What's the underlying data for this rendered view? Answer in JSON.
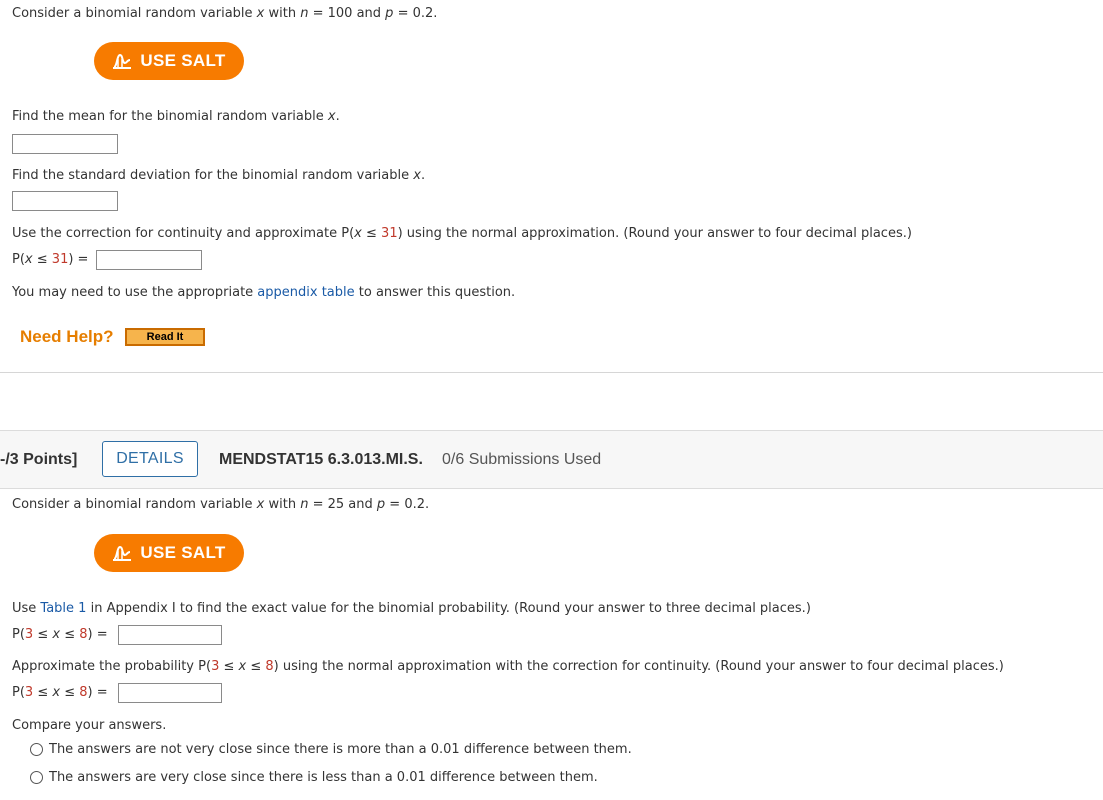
{
  "q1": {
    "intro": {
      "pre": "Consider a binomial random variable ",
      "var": "x",
      "mid1": " with ",
      "n_var": "n",
      "n_val": " = 100 and ",
      "p_var": "p",
      "p_val": " = 0.2."
    },
    "salt_label": "USE SALT",
    "mean_prompt": {
      "pre": "Find the mean for the binomial random variable ",
      "var": "x",
      "post": "."
    },
    "sd_prompt": {
      "pre": "Find the standard deviation for the binomial random variable ",
      "var": "x",
      "post": "."
    },
    "cont_prompt": {
      "pre": "Use the correction for continuity and approximate ",
      "p": "P(",
      "var": "x",
      "le": " ≤ ",
      "num": "31",
      "post": ") using the normal approximation. (Round your answer to four decimal places.)"
    },
    "answer_label": {
      "p": "P(",
      "var": "x",
      "le": " ≤ ",
      "num": "31",
      "close": ") ="
    },
    "appendix_note": {
      "pre": "You may need to use the appropriate ",
      "link": "appendix table",
      "post": " to answer this question."
    },
    "need_help": "Need Help?",
    "read_it": "Read It"
  },
  "q2_header": {
    "points": "-/3 Points]",
    "details": "DETAILS",
    "qid": "MENDSTAT15 6.3.013.MI.S.",
    "submissions": "0/6 Submissions Used"
  },
  "q2": {
    "intro": {
      "pre": "Consider a binomial random variable ",
      "var": "x",
      "mid1": " with ",
      "n_var": "n",
      "n_val": " = 25 and ",
      "p_var": "p",
      "p_val": " = 0.2."
    },
    "salt_label": "USE SALT",
    "table_prompt": {
      "pre": "Use ",
      "link": "Table 1",
      "post": " in Appendix I to find the exact value for the binomial probability. (Round your answer to three decimal places.)"
    },
    "prob_label1": {
      "p": "P(",
      "lo": "3",
      "le1": " ≤ ",
      "var": "x",
      "le2": " ≤ ",
      "hi": "8",
      "close": ") ="
    },
    "approx_prompt": {
      "pre": "Approximate the probability ",
      "p": "P(",
      "lo": "3",
      "le1": " ≤ ",
      "var": "x",
      "le2": " ≤ ",
      "hi": "8",
      "post": ") using the normal approximation with the correction for continuity. (Round your answer to four decimal places.)"
    },
    "prob_label2": {
      "p": "P(",
      "lo": "3",
      "le1": " ≤ ",
      "var": "x",
      "le2": " ≤ ",
      "hi": "8",
      "close": ") ="
    },
    "compare": "Compare your answers.",
    "options": [
      "The answers are not very close since there is more than a 0.01 difference between them.",
      "The answers are very close since there is less than a 0.01 difference between them."
    ]
  },
  "colors": {
    "salt_orange": "#f77b00",
    "red_number": "#c0392b",
    "link_blue": "#1a5aa6",
    "help_orange": "#e67e00"
  },
  "icons": {
    "salt": "salt-chart-icon"
  }
}
